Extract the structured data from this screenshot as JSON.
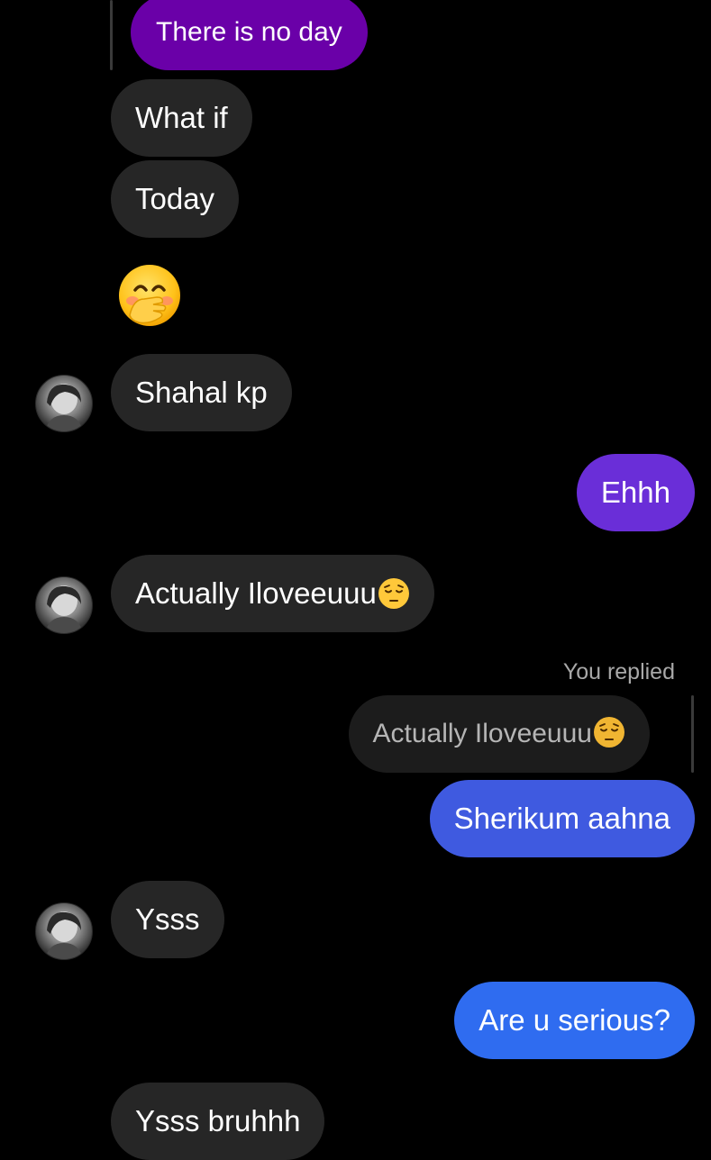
{
  "colors": {
    "background": "#000000",
    "incoming_bubble": "#262626",
    "quoted_bubble": "#1c1c1c",
    "outgoing_purple": "#6a00a8",
    "outgoing_violet": "#6a2ed8",
    "outgoing_indigo": "#3f5ae0",
    "outgoing_blue": "#2f6cf0",
    "reply_note": "#a8a8a8"
  },
  "messages": {
    "m1": {
      "text": "There is no day"
    },
    "m2": {
      "text": "What if"
    },
    "m3": {
      "text": "Today"
    },
    "m4": {
      "emoji": "🤭",
      "icon": "face-with-hand-over-mouth-icon"
    },
    "m5": {
      "text": "Shahal kp"
    },
    "m6": {
      "text": "Ehhh"
    },
    "m7": {
      "text": "Actually Iloveeuuu",
      "emoji": "😔",
      "icon": "pensive-face-icon"
    },
    "reply_note": "You replied",
    "m8_quote": {
      "text": "Actually Iloveeuuu",
      "emoji": "😔",
      "icon": "pensive-face-icon"
    },
    "m9": {
      "text": "Sherikum aahna"
    },
    "m10": {
      "text": "Ysss"
    },
    "m11": {
      "text": "Are u serious?"
    },
    "m12": {
      "text": "Ysss bruhhh"
    }
  }
}
